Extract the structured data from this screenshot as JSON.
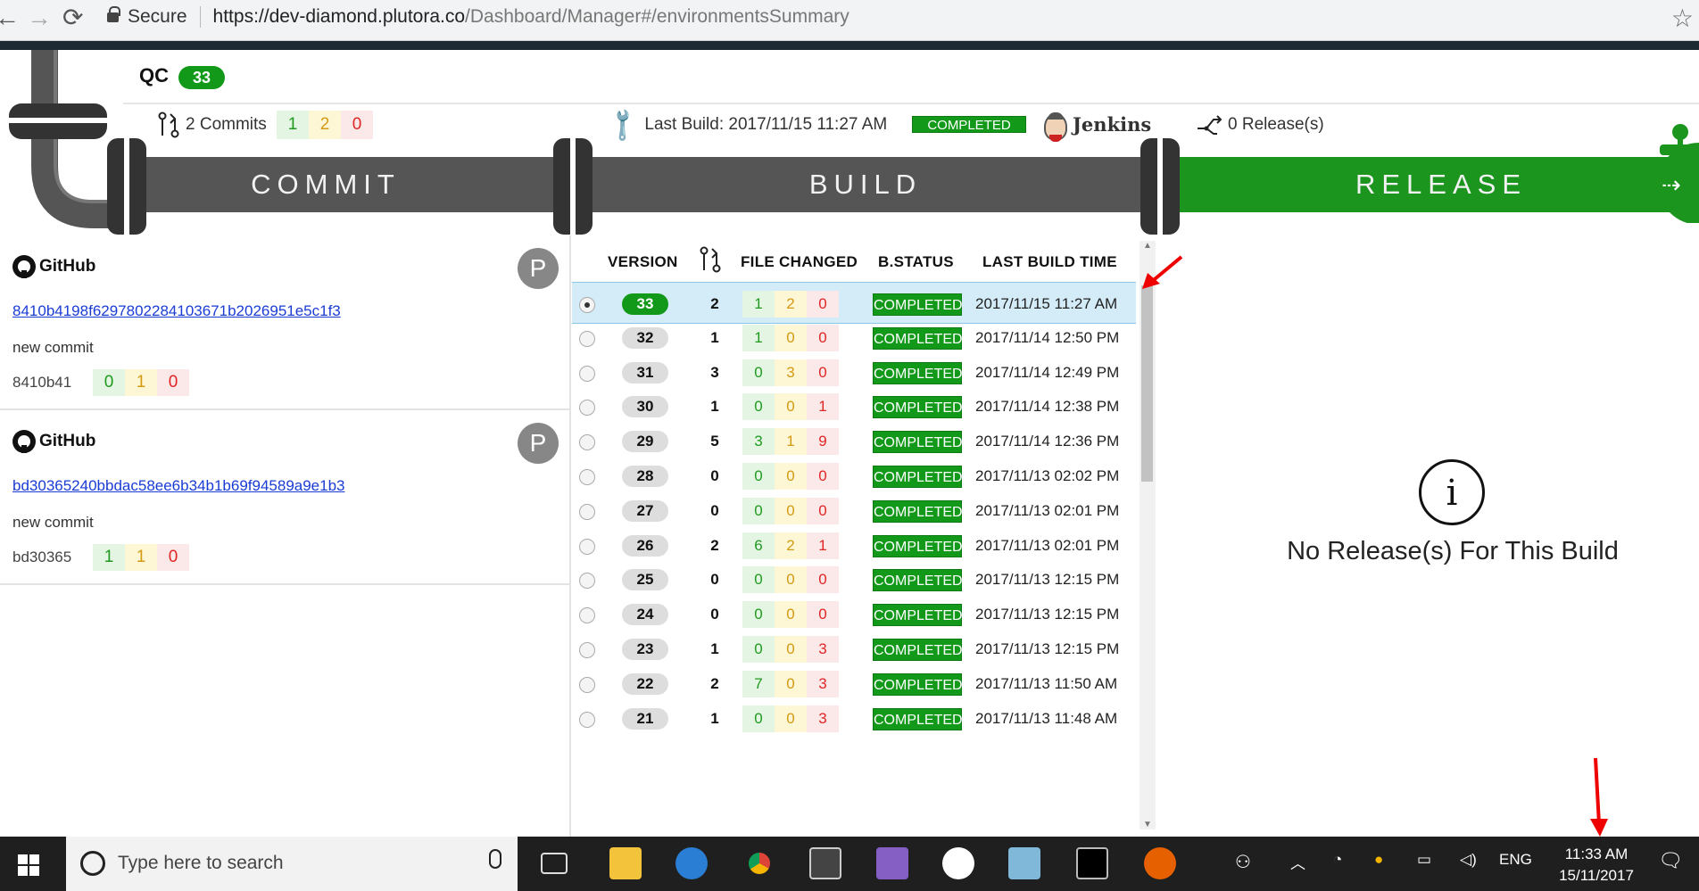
{
  "browser": {
    "secure_label": "Secure",
    "url_host": "https://dev-diamond.plutora.co",
    "url_path": "/Dashboard/Manager#/environmentsSummary"
  },
  "environment": {
    "name": "QC",
    "build_number": "33"
  },
  "summary": {
    "commits_label": "2 Commits",
    "commit_counts": {
      "added": "1",
      "modified": "2",
      "deleted": "0"
    },
    "last_build_label": "Last Build: 2017/11/15 11:27 AM",
    "status": "COMPLETED",
    "ci_tool": "Jenkins",
    "releases_label": "0 Release(s)"
  },
  "pipeline": {
    "commit": "COMMIT",
    "build": "BUILD",
    "release": "RELEASE"
  },
  "commits": [
    {
      "provider": "GitHub",
      "avatar": "P",
      "hash": "8410b4198f6297802284103671b2026951e5c1f3",
      "message": "new commit",
      "short": "8410b41",
      "added": "0",
      "modified": "1",
      "deleted": "0"
    },
    {
      "provider": "GitHub",
      "avatar": "P",
      "hash": "bd30365240bbdac58ee6b34b1b69f94589a9e1b3",
      "message": "new commit",
      "short": "bd30365",
      "added": "1",
      "modified": "1",
      "deleted": "0"
    }
  ],
  "builds_table": {
    "headers": {
      "version": "VERSION",
      "files": "FILE CHANGED",
      "status": "B.STATUS",
      "time": "LAST BUILD TIME"
    },
    "rows": [
      {
        "version": "33",
        "commits": "2",
        "added": "1",
        "modified": "2",
        "deleted": "0",
        "status": "COMPLETED",
        "time": "2017/11/15 11:27 AM"
      },
      {
        "version": "32",
        "commits": "1",
        "added": "1",
        "modified": "0",
        "deleted": "0",
        "status": "COMPLETED",
        "time": "2017/11/14 12:50 PM"
      },
      {
        "version": "31",
        "commits": "3",
        "added": "0",
        "modified": "3",
        "deleted": "0",
        "status": "COMPLETED",
        "time": "2017/11/14 12:49 PM"
      },
      {
        "version": "30",
        "commits": "1",
        "added": "0",
        "modified": "0",
        "deleted": "1",
        "status": "COMPLETED",
        "time": "2017/11/14 12:38 PM"
      },
      {
        "version": "29",
        "commits": "5",
        "added": "3",
        "modified": "1",
        "deleted": "9",
        "status": "COMPLETED",
        "time": "2017/11/14 12:36 PM"
      },
      {
        "version": "28",
        "commits": "0",
        "added": "0",
        "modified": "0",
        "deleted": "0",
        "status": "COMPLETED",
        "time": "2017/11/13 02:02 PM"
      },
      {
        "version": "27",
        "commits": "0",
        "added": "0",
        "modified": "0",
        "deleted": "0",
        "status": "COMPLETED",
        "time": "2017/11/13 02:01 PM"
      },
      {
        "version": "26",
        "commits": "2",
        "added": "6",
        "modified": "2",
        "deleted": "1",
        "status": "COMPLETED",
        "time": "2017/11/13 02:01 PM"
      },
      {
        "version": "25",
        "commits": "0",
        "added": "0",
        "modified": "0",
        "deleted": "0",
        "status": "COMPLETED",
        "time": "2017/11/13 12:15 PM"
      },
      {
        "version": "24",
        "commits": "0",
        "added": "0",
        "modified": "0",
        "deleted": "0",
        "status": "COMPLETED",
        "time": "2017/11/13 12:15 PM"
      },
      {
        "version": "23",
        "commits": "1",
        "added": "0",
        "modified": "0",
        "deleted": "3",
        "status": "COMPLETED",
        "time": "2017/11/13 12:15 PM"
      },
      {
        "version": "22",
        "commits": "2",
        "added": "7",
        "modified": "0",
        "deleted": "3",
        "status": "COMPLETED",
        "time": "2017/11/13 11:50 AM"
      },
      {
        "version": "21",
        "commits": "1",
        "added": "0",
        "modified": "0",
        "deleted": "3",
        "status": "COMPLETED",
        "time": "2017/11/13 11:48 AM"
      }
    ]
  },
  "release_panel": {
    "empty_message": "No Release(s) For This Build"
  },
  "taskbar": {
    "search_placeholder": "Type here to search",
    "language": "ENG",
    "time": "11:33 AM",
    "date": "15/11/2017"
  },
  "colors": {
    "accent_green": "#13991a",
    "pipe_gray": "#555555",
    "selected_row": "#d4ecf8",
    "annotation_red": "#e00000"
  }
}
